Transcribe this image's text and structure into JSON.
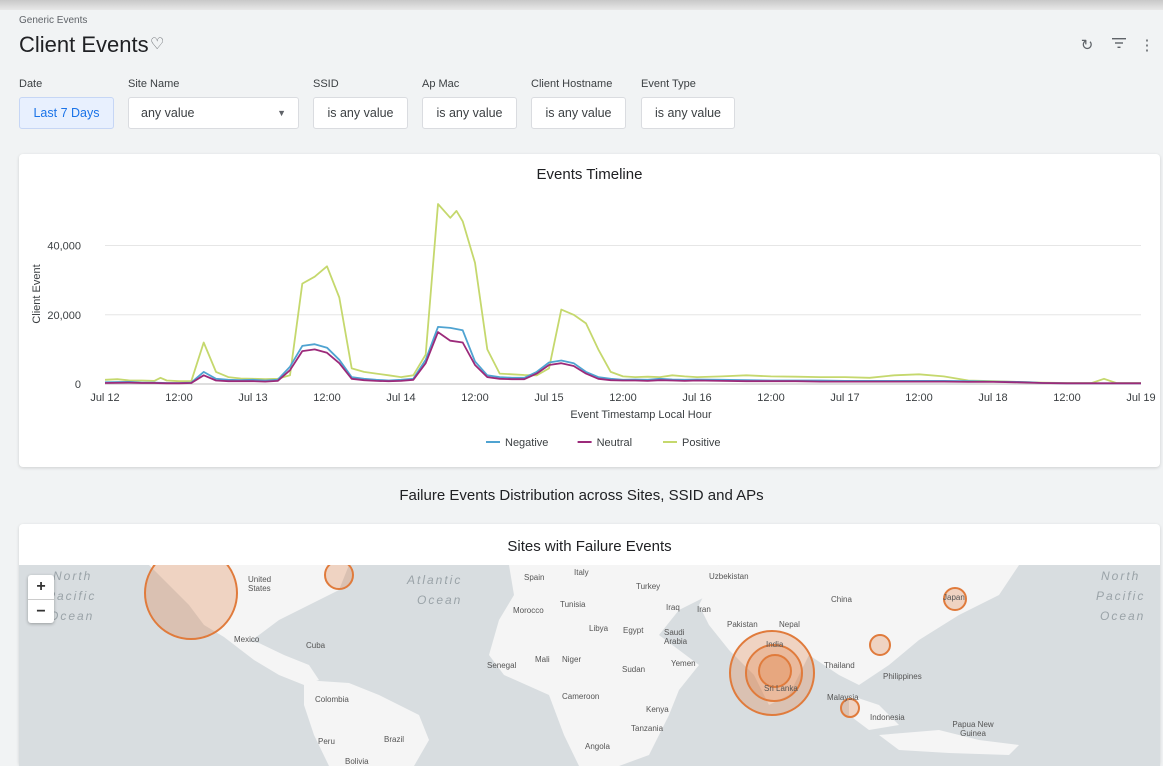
{
  "breadcrumb": "Generic Events",
  "title": "Client Events",
  "filters": [
    {
      "label": "Date",
      "value": "Last 7 Days"
    },
    {
      "label": "Site Name",
      "value": "any value"
    },
    {
      "label": "SSID",
      "value": "is any value"
    },
    {
      "label": "Ap Mac",
      "value": "is any value"
    },
    {
      "label": "Client Hostname",
      "value": "is any value"
    },
    {
      "label": "Event Type",
      "value": "is any value"
    }
  ],
  "icons": [
    "refresh-icon",
    "filter-icon",
    "more-vert-icon",
    "heart-icon"
  ],
  "section_title": "Failure Events Distribution across Sites, SSID and APs",
  "map": {
    "title": "Sites with Failure Events",
    "zoom_in": "+",
    "zoom_out": "−",
    "labels": [
      "United States",
      "Mexico",
      "Cuba",
      "Colombia",
      "Peru",
      "Brazil",
      "Bolivia",
      "Spain",
      "Italy",
      "Turkey",
      "Uzbekistan",
      "Tunisia",
      "Morocco",
      "Libya",
      "Egypt",
      "Iraq",
      "Iran",
      "Saudi Arabia",
      "Pakistan",
      "Nepal",
      "India",
      "Sri Lanka",
      "China",
      "Japan",
      "Senegal",
      "Mali",
      "Niger",
      "Sudan",
      "Yemen",
      "Cameroon",
      "Kenya",
      "Tanzania",
      "Angola",
      "Thailand",
      "Philippines",
      "Malaysia",
      "Indonesia",
      "Papua New Guinea"
    ],
    "oceans": [
      "North",
      "Pacific",
      "Ocean",
      "Atlantic",
      "Ocean",
      "North",
      "Pacific",
      "Ocean"
    ],
    "bubble_color": "#e07b3c"
  },
  "chart_data": {
    "type": "line",
    "title": "Events Timeline",
    "xlabel": "Event Timestamp Local Hour",
    "ylabel": "Client Event",
    "ylim": [
      0,
      52000
    ],
    "y_ticks": [
      "0",
      "20,000",
      "40,000"
    ],
    "x_ticks": [
      "Jul 12",
      "12:00",
      "Jul 13",
      "12:00",
      "Jul 14",
      "12:00",
      "Jul 15",
      "12:00",
      "Jul 16",
      "12:00",
      "Jul 17",
      "12:00",
      "Jul 18",
      "12:00",
      "Jul 19"
    ],
    "x_hours": [
      0,
      12,
      24,
      36,
      48,
      60,
      72,
      84,
      96,
      108,
      120,
      132,
      144,
      156,
      168
    ],
    "legend": "bottom",
    "series": [
      {
        "name": "Negative",
        "color": "#4fa3d1",
        "x": [
          0,
          4,
          6,
          8,
          10,
          12,
          14,
          16,
          18,
          20,
          22,
          24,
          26,
          28,
          30,
          32,
          34,
          36,
          38,
          40,
          42,
          44,
          46,
          48,
          50,
          52,
          54,
          56,
          58,
          60,
          62,
          64,
          66,
          68,
          70,
          72,
          74,
          76,
          78,
          80,
          82,
          84,
          86,
          88,
          90,
          92,
          94,
          96,
          100,
          104,
          108,
          112,
          116,
          120,
          124,
          128,
          132,
          136,
          140,
          144,
          148,
          150,
          152,
          156,
          160,
          164,
          168
        ],
        "y": [
          500,
          600,
          400,
          400,
          300,
          300,
          400,
          3500,
          1500,
          1200,
          1100,
          1200,
          1000,
          1200,
          5000,
          11000,
          11500,
          10500,
          7000,
          2000,
          1500,
          1200,
          1000,
          1200,
          1500,
          7000,
          16500,
          16200,
          15500,
          6500,
          2500,
          2000,
          1800,
          1800,
          3500,
          6200,
          6800,
          6000,
          3500,
          2000,
          1500,
          1200,
          1300,
          1200,
          1500,
          1300,
          1200,
          1300,
          1200,
          1100,
          1000,
          1000,
          1000,
          900,
          900,
          900,
          900,
          900,
          800,
          700,
          600,
          500,
          300,
          200,
          200,
          200,
          200
        ]
      },
      {
        "name": "Neutral",
        "color": "#9c2a7a",
        "x": [
          0,
          4,
          6,
          8,
          10,
          12,
          14,
          16,
          18,
          20,
          22,
          24,
          26,
          28,
          30,
          32,
          34,
          36,
          38,
          40,
          42,
          44,
          46,
          48,
          50,
          52,
          54,
          56,
          58,
          60,
          62,
          64,
          66,
          68,
          70,
          72,
          74,
          76,
          78,
          80,
          82,
          84,
          86,
          88,
          90,
          92,
          94,
          96,
          100,
          104,
          108,
          112,
          116,
          120,
          124,
          128,
          132,
          136,
          140,
          144,
          148,
          150,
          152,
          156,
          160,
          164,
          168
        ],
        "y": [
          300,
          400,
          300,
          300,
          200,
          200,
          300,
          2500,
          1000,
          800,
          800,
          800,
          700,
          900,
          4000,
          9500,
          10000,
          9000,
          6000,
          1500,
          1100,
          900,
          800,
          900,
          1200,
          6000,
          15000,
          12500,
          12000,
          5500,
          2000,
          1500,
          1400,
          1400,
          3000,
          5500,
          6000,
          5200,
          3000,
          1500,
          1100,
          1000,
          1000,
          900,
          1100,
          1000,
          900,
          1000,
          900,
          800,
          800,
          800,
          700,
          700,
          700,
          700,
          700,
          700,
          600,
          600,
          500,
          400,
          300,
          200,
          200,
          200,
          200
        ]
      },
      {
        "name": "Positive",
        "color": "#c5d86d",
        "x": [
          0,
          2,
          4,
          6,
          8,
          9,
          10,
          12,
          14,
          16,
          18,
          20,
          22,
          24,
          26,
          28,
          30,
          32,
          34,
          36,
          38,
          40,
          42,
          44,
          46,
          48,
          50,
          52,
          54,
          56,
          57,
          58,
          60,
          62,
          64,
          66,
          68,
          70,
          72,
          74,
          76,
          78,
          80,
          82,
          84,
          86,
          88,
          90,
          92,
          94,
          96,
          100,
          104,
          108,
          112,
          116,
          120,
          124,
          128,
          132,
          136,
          140,
          144,
          148,
          150,
          152,
          156,
          160,
          162,
          164,
          168
        ],
        "y": [
          1200,
          1400,
          1000,
          1000,
          900,
          1800,
          1000,
          800,
          800,
          12000,
          3500,
          2000,
          1600,
          1500,
          1400,
          1500,
          2500,
          29000,
          31000,
          34000,
          25000,
          4500,
          3500,
          3000,
          2500,
          2000,
          2500,
          8500,
          52000,
          48000,
          50000,
          47000,
          35000,
          10000,
          3000,
          2800,
          2600,
          2500,
          4500,
          21500,
          20000,
          17500,
          10000,
          3500,
          2200,
          2000,
          2100,
          2000,
          2500,
          2200,
          2000,
          2200,
          2500,
          2200,
          2100,
          2000,
          2000,
          1800,
          2500,
          2800,
          2200,
          1000,
          800,
          600,
          500,
          400,
          300,
          300,
          1500,
          300,
          300
        ]
      }
    ]
  }
}
